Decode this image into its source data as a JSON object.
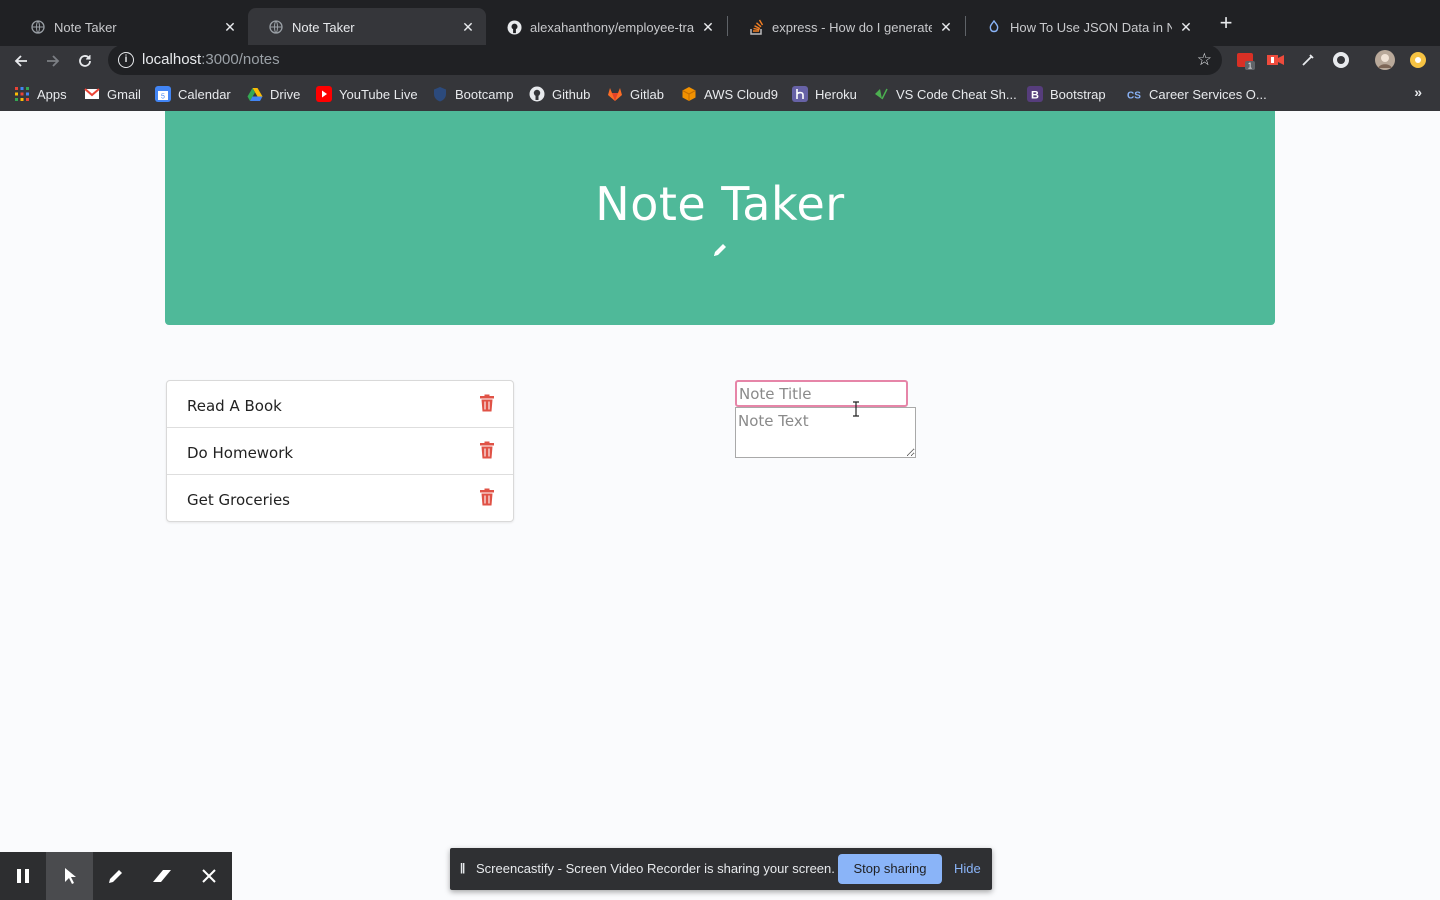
{
  "browser": {
    "tabs": [
      {
        "title": "Note Taker",
        "active": false
      },
      {
        "title": "Note Taker",
        "active": true
      },
      {
        "title": "alexahanthony/employee-track",
        "active": false
      },
      {
        "title": "express - How do I generate JS",
        "active": false
      },
      {
        "title": "How To Use JSON Data in Nod",
        "active": false
      }
    ],
    "url_host": "localhost",
    "url_path": ":3000/notes",
    "bookmarks": [
      "Apps",
      "Gmail",
      "Calendar",
      "Drive",
      "YouTube Live",
      "Bootcamp",
      "Github",
      "Gitlab",
      "AWS Cloud9",
      "Heroku",
      "VS Code Cheat Sh...",
      "Bootstrap",
      "Career Services O..."
    ],
    "bookmarks_more": "»",
    "extension_badge": "1"
  },
  "page": {
    "title": "Note Taker",
    "notes": [
      {
        "title": "Read A Book"
      },
      {
        "title": "Do Homework"
      },
      {
        "title": "Get Groceries"
      }
    ],
    "note_title_placeholder": "Note Title",
    "note_text_placeholder": "Note Text",
    "accent_color": "#4fb999",
    "delete_color": "#e05246"
  },
  "screencastify": {
    "message": "Screencastify - Screen Video Recorder is sharing your screen.",
    "stop_label": "Stop sharing",
    "hide_label": "Hide"
  }
}
